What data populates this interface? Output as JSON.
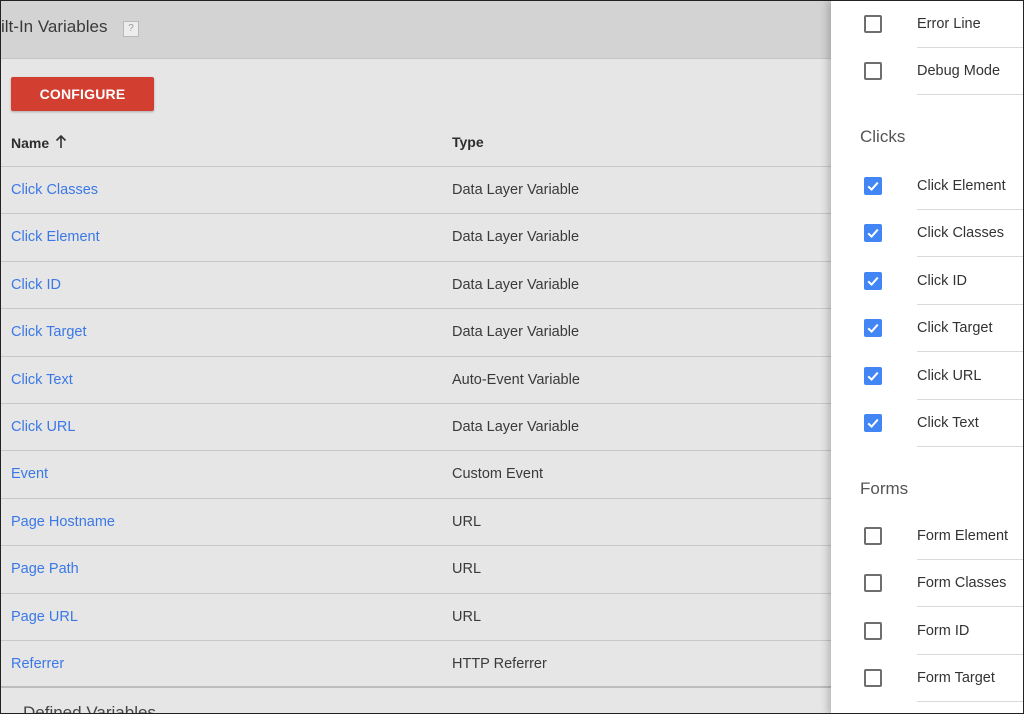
{
  "panel": {
    "title": "ilt-In Variables",
    "help_icon": "?",
    "configure_label": "CONFIGURE",
    "columns": {
      "name": "Name",
      "type": "Type"
    },
    "sort_icon": "arrow-up-icon",
    "rows": [
      {
        "name": "Click Classes",
        "type": "Data Layer Variable"
      },
      {
        "name": "Click Element",
        "type": "Data Layer Variable"
      },
      {
        "name": "Click ID",
        "type": "Data Layer Variable"
      },
      {
        "name": "Click Target",
        "type": "Data Layer Variable"
      },
      {
        "name": "Click Text",
        "type": "Auto-Event Variable"
      },
      {
        "name": "Click URL",
        "type": "Data Layer Variable"
      },
      {
        "name": "Event",
        "type": "Custom Event"
      },
      {
        "name": "Page Hostname",
        "type": "URL"
      },
      {
        "name": "Page Path",
        "type": "URL"
      },
      {
        "name": "Page URL",
        "type": "URL"
      },
      {
        "name": "Referrer",
        "type": "HTTP Referrer"
      }
    ],
    "next_section_partial": "Defined Variables"
  },
  "sidebar": {
    "top_items": [
      {
        "label": "Error Line",
        "checked": false
      },
      {
        "label": "Debug Mode",
        "checked": false
      }
    ],
    "clicks": {
      "title": "Clicks",
      "items": [
        {
          "label": "Click Element",
          "checked": true
        },
        {
          "label": "Click Classes",
          "checked": true
        },
        {
          "label": "Click ID",
          "checked": true
        },
        {
          "label": "Click Target",
          "checked": true
        },
        {
          "label": "Click URL",
          "checked": true
        },
        {
          "label": "Click Text",
          "checked": true
        }
      ]
    },
    "forms": {
      "title": "Forms",
      "items": [
        {
          "label": "Form Element",
          "checked": false
        },
        {
          "label": "Form Classes",
          "checked": false
        },
        {
          "label": "Form ID",
          "checked": false
        },
        {
          "label": "Form Target",
          "checked": false
        }
      ]
    }
  },
  "colors": {
    "link": "#3b78e7",
    "configure_button": "#d23f31",
    "checkbox_checked": "#4285f4",
    "header_bg": "#d3d3d3",
    "panel_bg": "#e6e6e6"
  }
}
